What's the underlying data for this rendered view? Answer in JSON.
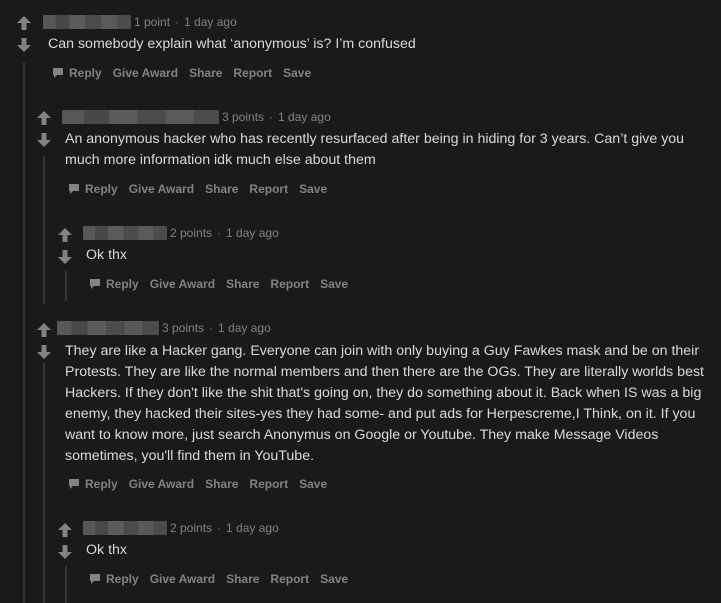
{
  "colors": {
    "background": "#1a1a1b",
    "text": "#d7dadc",
    "muted": "#818384",
    "thread_line": "#343536"
  },
  "icons": {
    "upvote": "arrow-up-icon",
    "downvote": "arrow-down-icon",
    "reply": "speech-bubble-icon"
  },
  "actions": {
    "reply": "Reply",
    "give_award": "Give Award",
    "share": "Share",
    "report": "Report",
    "save": "Save"
  },
  "comments": [
    {
      "points": "1 point",
      "time": "1 day ago",
      "body": "Can somebody explain what ‘anonymous’ is? I’m confused"
    },
    {
      "points": "3 points",
      "time": "1 day ago",
      "body": "An anonymous hacker who has recently resurfaced after being in hiding for 3 years. Can’t give you much more information idk much else about them"
    },
    {
      "points": "2 points",
      "time": "1 day ago",
      "body": "Ok thx"
    },
    {
      "points": "3 points",
      "time": "1 day ago",
      "body": "They are like a Hacker gang. Everyone can join with only buying a Guy Fawkes mask and be on their Protests. They are like the normal members and then there are the OGs. They are literally worlds best Hackers. If they don't like the shit that's going on, they do something about it. Back when IS was a big enemy, they hacked their sites-yes they had some- and put ads for Herpescreme,I Think, on it. If you want to know more, just search Anonymus on Google or Youtube. They make Message Videos sometimes, you'll find them in YouTube."
    },
    {
      "points": "2 points",
      "time": "1 day ago",
      "body": "Ok thx"
    }
  ]
}
